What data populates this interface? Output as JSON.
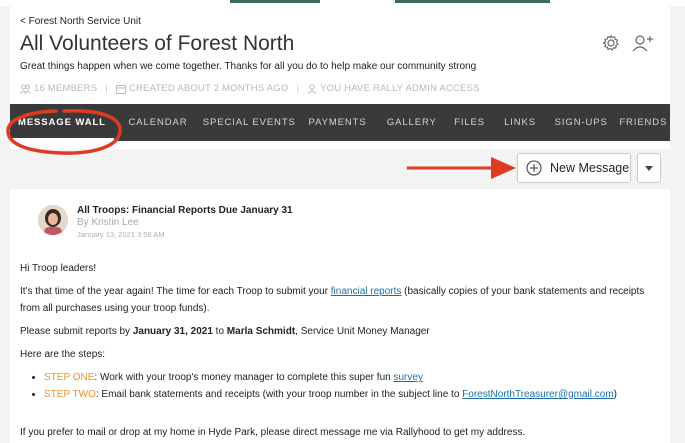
{
  "breadcrumb": "< Forest North Service Unit",
  "header": {
    "title": "All Volunteers of Forest North",
    "tagline": "Great things happen when we come together. Thanks for all you do to help make our community strong",
    "meta": {
      "members": "16 MEMBERS",
      "created": "CREATED ABOUT 2 MONTHS AGO",
      "access": "YOU HAVE RALLY ADMIN ACCESS"
    },
    "icons": [
      "gear-icon",
      "add-person-icon"
    ]
  },
  "nav": {
    "tabs": [
      "MESSAGE WALL",
      "CALENDAR",
      "SPECIAL EVENTS",
      "PAYMENTS",
      "GALLERY",
      "FILES",
      "LINKS",
      "SIGN-UPS",
      "FRIENDS"
    ],
    "active": "MESSAGE WALL"
  },
  "toolbar": {
    "new_message_label": "New Message"
  },
  "post": {
    "title": "All Troops: Financial Reports Due January 31",
    "author": "By Kristin Lee",
    "date": "January 13, 2021 3:58 AM",
    "greeting": "Hi Troop leaders!",
    "p1_before": "It's that time of the year again! The time for each Troop to submit your ",
    "p1_link": "financial reports",
    "p1_after": " (basically copies of your bank statements and receipts from all purchases using your troop funds).",
    "p2_before": "Please submit reports by ",
    "p2_date": "January 31, 2021",
    "p2_mid": " to ",
    "p2_name": "Marla Schmidt",
    "p2_after": ", Service Unit Money Manager",
    "steps_intro": "Here are the steps:",
    "step1_label": "STEP ONE",
    "step1_text": ": Work with your troop's money manager to complete this super fun ",
    "step1_link": "survey",
    "step2_label": "STEP TWO",
    "step2_text": ": Email bank statements and receipts (with your troop number in the subject line to ",
    "step2_link": "ForestNorthTreasurer@gmail.com",
    "step2_end": ")",
    "last_line": "If you prefer to mail or drop at my home in Hyde Park, please direct message me via Rallyhood to get my address."
  },
  "colors": {
    "nav_bg": "#3a3a3a",
    "link": "#1d6fa8",
    "step_accent": "#e8962e",
    "annotation_red": "#e03a22"
  }
}
